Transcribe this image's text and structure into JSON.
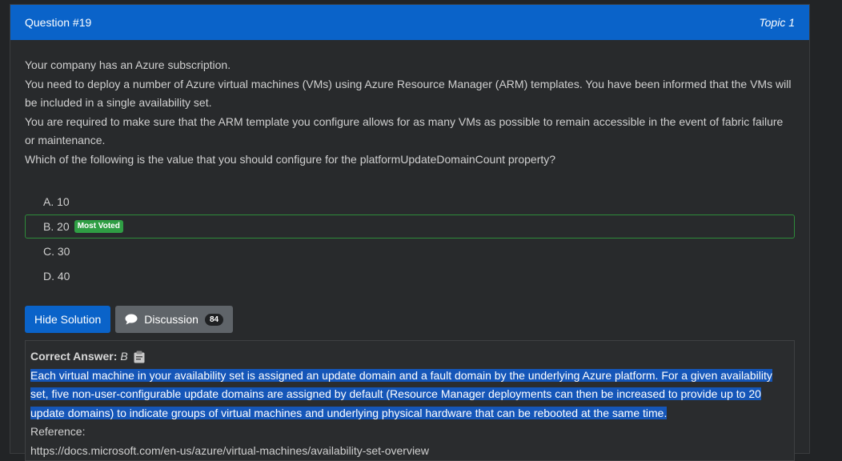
{
  "header": {
    "question": "Question #19",
    "topic": "Topic 1"
  },
  "question": {
    "lines": [
      "Your company has an Azure subscription.",
      "You need to deploy a number of Azure virtual machines (VMs) using Azure Resource Manager (ARM) templates. You have been informed that the VMs will be included in a single availability set.",
      "You are required to make sure that the ARM template you configure allows for as many VMs as possible to remain accessible in the event of fabric failure or maintenance.",
      "Which of the following is the value that you should configure for the platformUpdateDomainCount property?"
    ]
  },
  "choices": [
    {
      "label": "A. 10"
    },
    {
      "label": "B. 20",
      "badge": "Most Voted"
    },
    {
      "label": "C. 30"
    },
    {
      "label": "D. 40"
    }
  ],
  "buttons": {
    "hide_solution": "Hide Solution",
    "discussion": "Discussion",
    "discussion_count": "84"
  },
  "answer": {
    "title": "Correct Answer:",
    "letter": "B",
    "explanation": "Each virtual machine in your availability set is assigned an update domain and a fault domain by the underlying Azure platform. For a given availability set, five non-user-configurable update domains are assigned by default (Resource Manager deployments can then be increased to provide up to 20 update domains) to indicate groups of virtual machines and underlying physical hardware that can be rebooted at the same time.",
    "reference_label": "Reference:",
    "reference_url": "https://docs.microsoft.com/en-us/azure/virtual-machines/availability-set-overview"
  },
  "colors": {
    "header": "#0a63c9",
    "badge": "#2f9e44",
    "highlight": "#1556b8"
  }
}
